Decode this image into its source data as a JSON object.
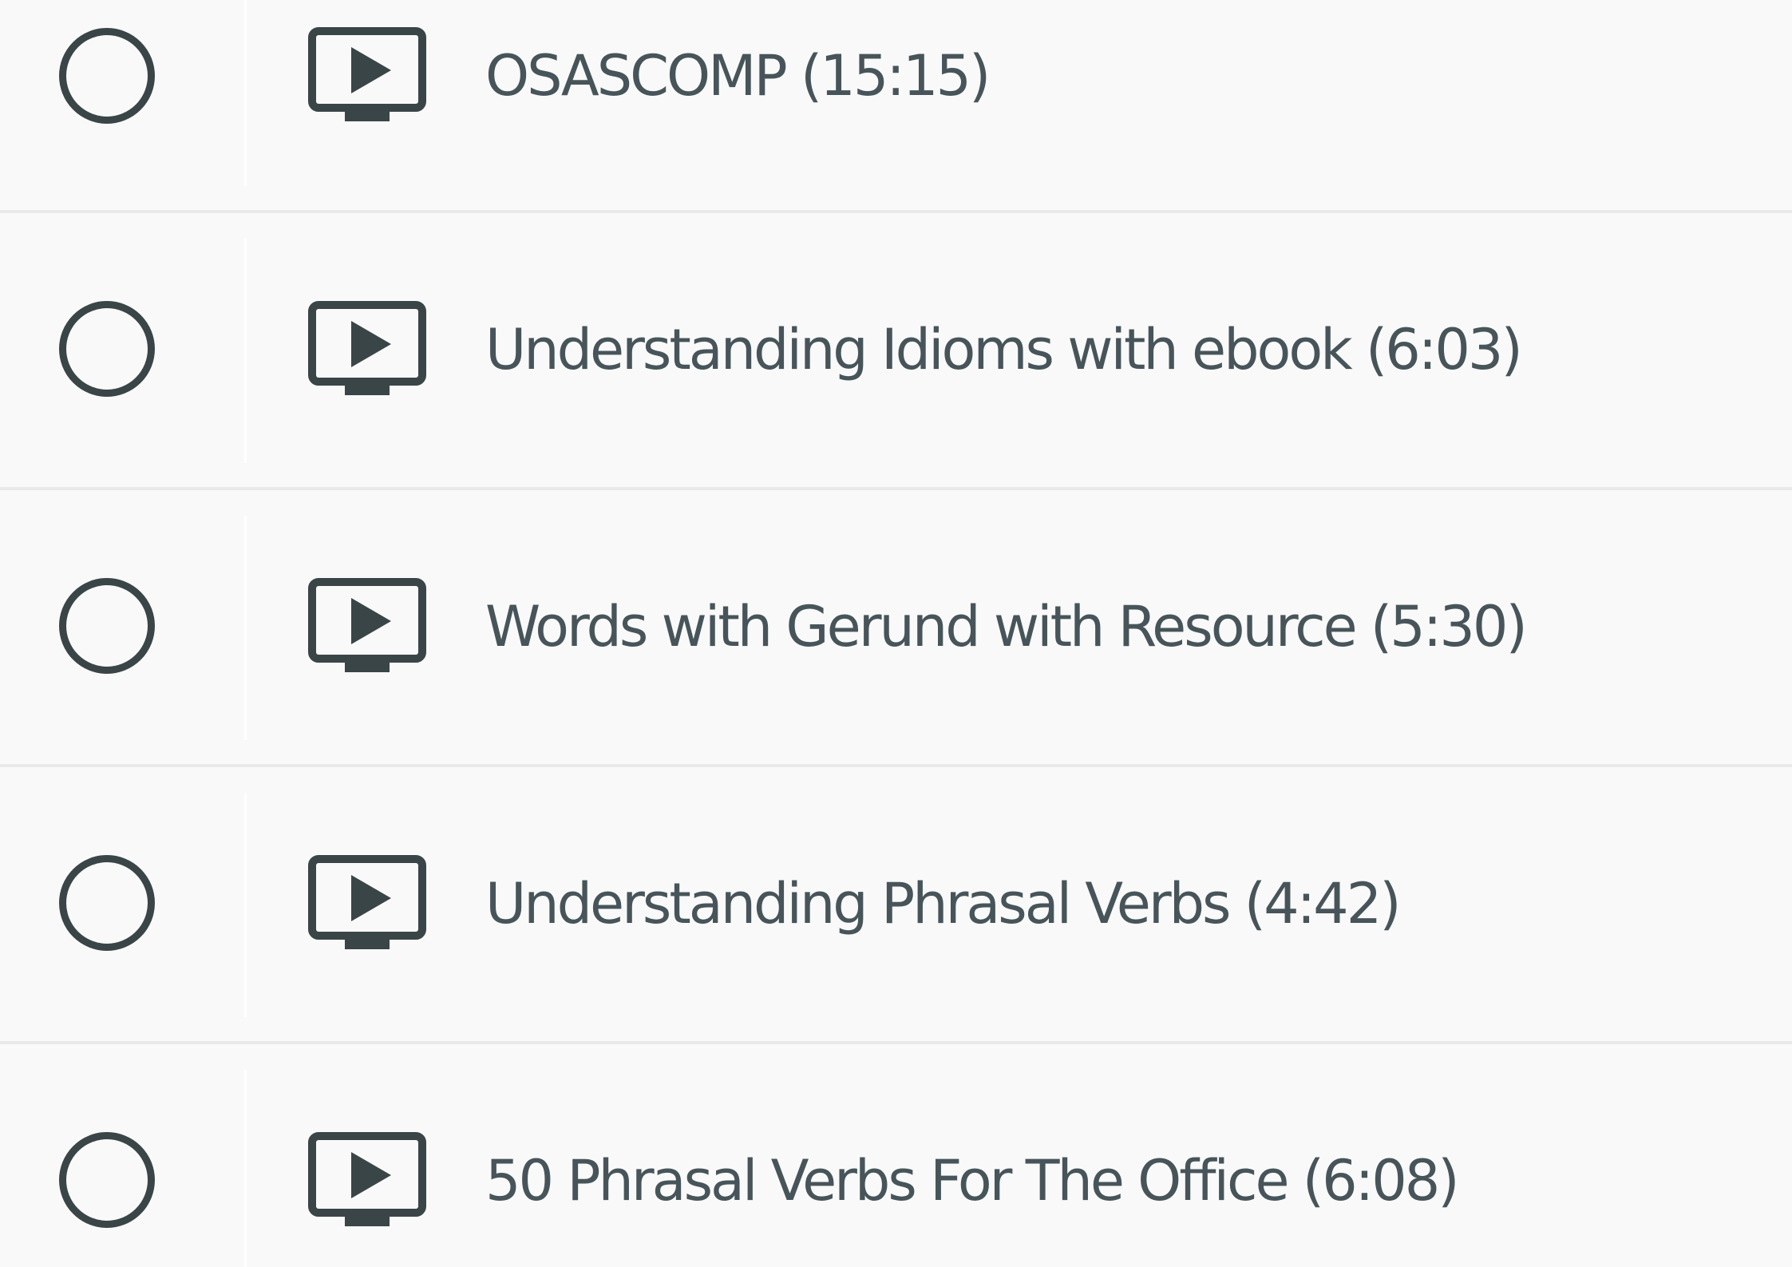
{
  "lessons": [
    {
      "title": "OSASCOMP (15:15)",
      "icon": "video-icon",
      "completed": false
    },
    {
      "title": "Understanding Idioms with ebook (6:03)",
      "icon": "video-icon",
      "completed": false
    },
    {
      "title": "Words with Gerund with Resource (5:30)",
      "icon": "video-icon",
      "completed": false
    },
    {
      "title": "Understanding Phrasal Verbs (4:42)",
      "icon": "video-icon",
      "completed": false
    },
    {
      "title": "50 Phrasal Verbs For The Office (6:08)",
      "icon": "video-icon",
      "completed": false
    }
  ],
  "colors": {
    "background": "#f9f9f9",
    "icon": "#3a4547",
    "text": "#47555a",
    "separator": "#e9e9e9"
  }
}
